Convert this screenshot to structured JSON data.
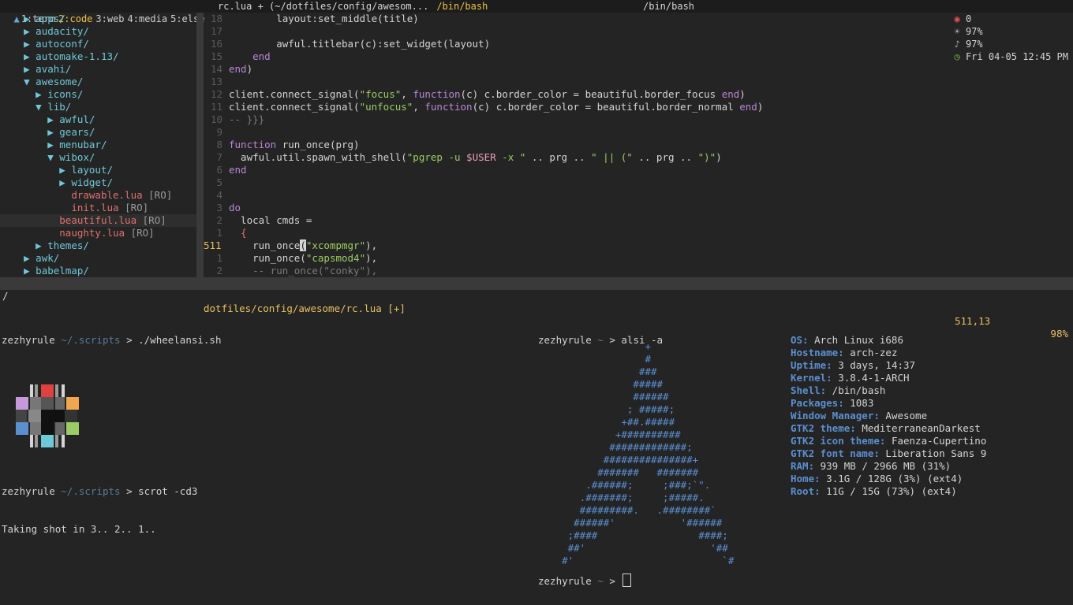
{
  "topbar": {
    "workspaces": [
      {
        "label": "1:term",
        "active": false
      },
      {
        "label": "2:code",
        "active": true
      },
      {
        "label": "3:web",
        "active": false
      },
      {
        "label": "4:media",
        "active": false
      },
      {
        "label": "5:else",
        "active": false
      }
    ],
    "window_title": "rc.lua + (~/dotfiles/config/awesom...",
    "window_shell": "/bin/bash",
    "center_title": "/bin/bash",
    "status": {
      "mail": "0",
      "brightness": "97%",
      "volume": "97%",
      "clock": "Fri 04-05 12:45 PM"
    }
  },
  "tree": [
    {
      "indent": 2,
      "arrow": "▶",
      "name": "apps/",
      "type": "dir"
    },
    {
      "indent": 2,
      "arrow": "▶",
      "name": "audacity/",
      "type": "dir"
    },
    {
      "indent": 2,
      "arrow": "▶",
      "name": "autoconf/",
      "type": "dir"
    },
    {
      "indent": 2,
      "arrow": "▶",
      "name": "automake-1.13/",
      "type": "dir"
    },
    {
      "indent": 2,
      "arrow": "▶",
      "name": "avahi/",
      "type": "dir"
    },
    {
      "indent": 2,
      "arrow": "▼",
      "name": "awesome/",
      "type": "dir"
    },
    {
      "indent": 4,
      "arrow": "▶",
      "name": "icons/",
      "type": "dir"
    },
    {
      "indent": 4,
      "arrow": "▼",
      "name": "lib/",
      "type": "dir"
    },
    {
      "indent": 6,
      "arrow": "▶",
      "name": "awful/",
      "type": "dir"
    },
    {
      "indent": 6,
      "arrow": "▶",
      "name": "gears/",
      "type": "dir"
    },
    {
      "indent": 6,
      "arrow": "▶",
      "name": "menubar/",
      "type": "dir"
    },
    {
      "indent": 6,
      "arrow": "▼",
      "name": "wibox/",
      "type": "dir"
    },
    {
      "indent": 8,
      "arrow": "▶",
      "name": "layout/",
      "type": "dir"
    },
    {
      "indent": 8,
      "arrow": "▶",
      "name": "widget/",
      "type": "dir"
    },
    {
      "indent": 10,
      "arrow": "",
      "name": "drawable.lua",
      "type": "file",
      "tag": "[RO]"
    },
    {
      "indent": 10,
      "arrow": "",
      "name": "init.lua",
      "type": "file",
      "tag": "[RO]"
    },
    {
      "indent": 8,
      "arrow": "",
      "name": "beautiful.lua",
      "type": "file",
      "tag": "[RO]",
      "highlight": true
    },
    {
      "indent": 8,
      "arrow": "",
      "name": "naughty.lua",
      "type": "file",
      "tag": "[RO]"
    },
    {
      "indent": 4,
      "arrow": "▶",
      "name": "themes/",
      "type": "dir"
    },
    {
      "indent": 2,
      "arrow": "▶",
      "name": "awk/",
      "type": "dir"
    },
    {
      "indent": 2,
      "arrow": "▶",
      "name": "babelmap/",
      "type": "dir"
    }
  ],
  "code": [
    {
      "ln": "18",
      "html": "        layout:set_middle(title)"
    },
    {
      "ln": "17",
      "html": ""
    },
    {
      "ln": "16",
      "html": "        awful.titlebar(c):set_widget(layout)"
    },
    {
      "ln": "15",
      "html": "    <span class='kw'>end</span>"
    },
    {
      "ln": "14",
      "html": "<span class='kw'>end</span>)"
    },
    {
      "ln": "13",
      "html": ""
    },
    {
      "ln": "12",
      "html": "client.connect_signal(<span class='str'>\"focus\"</span>, <span class='kw'>function</span>(c) c.border_color = beautiful.border_focus <span class='kw'>end</span>)"
    },
    {
      "ln": "11",
      "html": "client.connect_signal(<span class='str'>\"unfocus\"</span>, <span class='kw'>function</span>(c) c.border_color = beautiful.border_normal <span class='kw'>end</span>)"
    },
    {
      "ln": "10",
      "html": "<span class='com'>-- }}}</span>"
    },
    {
      "ln": "9",
      "html": ""
    },
    {
      "ln": "8",
      "html": "<span class='kw'>function</span> run_once(prg)"
    },
    {
      "ln": "7",
      "html": "  awful.util.spawn_with_shell(<span class='str'>\"pgrep -u </span><span class='var'>$USER</span><span class='str'> -x \"</span> .. prg .. <span class='str'>\" || (\"</span> .. prg .. <span class='str'>\")\"</span>)"
    },
    {
      "ln": "6",
      "html": "<span class='kw'>end</span>"
    },
    {
      "ln": "5",
      "html": ""
    },
    {
      "ln": "4",
      "html": ""
    },
    {
      "ln": "3",
      "html": "<span class='kw'>do</span>"
    },
    {
      "ln": "2",
      "html": "  local cmds ="
    },
    {
      "ln": "1",
      "html": "  <span class='brace'>{</span>"
    },
    {
      "ln": "511",
      "cur": true,
      "html": "    run_once<span class='cursor'>(</span><span class='str'>\"xcompmgr\"</span>),"
    },
    {
      "ln": "1",
      "html": "    run_once(<span class='str'>\"capsmod4\"</span>),"
    },
    {
      "ln": "2",
      "html": "    <span class='com'>-- run_once(\"conky\"),</span>"
    }
  ],
  "statusline": {
    "left": "/",
    "file": "dotfiles/config/awesome/rc.lua [+]",
    "position": "511,13",
    "percent": "98%"
  },
  "term1": {
    "prompt1": {
      "user": "zezhyrule",
      "path": "~/.scripts",
      "arrow": ">",
      "cmd": "./wheelansi.sh"
    },
    "prompt2": {
      "user": "zezhyrule",
      "path": "~/.scripts",
      "arrow": ">",
      "cmd": "scrot -cd3"
    },
    "output": "Taking shot in 3.. 2.. 1.."
  },
  "term2": {
    "prompt1": {
      "user": "zezhyrule",
      "path": "~",
      "arrow": ">",
      "cmd": "alsi -a"
    },
    "prompt2": {
      "user": "zezhyrule",
      "path": "~",
      "arrow": ">"
    },
    "arch_art": "                  +\n                  #\n                 ###\n                #####\n                ######\n               ; #####;\n              +##.#####\n             +##########\n            #############;\n           ###############+\n          #######   #######\n        .######;     ;###;`\".\n       .#######;     ;#####.\n       #########.   .########`\n      ######'           '######\n     ;####                 ####;\n     ##'                     '##\n    #'                         `#",
    "info": [
      {
        "k": "OS:",
        "v": " Arch Linux i686"
      },
      {
        "k": "Hostname:",
        "v": " arch-zez"
      },
      {
        "k": "Uptime:",
        "v": " 3 days, 14:37"
      },
      {
        "k": "Kernel:",
        "v": " 3.8.4-1-ARCH"
      },
      {
        "k": "Shell:",
        "v": " /bin/bash"
      },
      {
        "k": "Packages:",
        "v": " 1083"
      },
      {
        "k": "Window Manager:",
        "v": " Awesome"
      },
      {
        "k": "GTK2 theme:",
        "v": " MediterraneanDarkest"
      },
      {
        "k": "GTK2 icon theme:",
        "v": " Faenza-Cupertino"
      },
      {
        "k": "GTK2 font name:",
        "v": " Liberation Sans 9"
      },
      {
        "k": "RAM:",
        "v": " 939 MB / 2966 MB (31%)"
      },
      {
        "k": "Home:",
        "v": " 3.1G / 128G (3%) (ext4)"
      },
      {
        "k": "Root:",
        "v": " 11G / 15G (73%) (ext4)"
      }
    ]
  },
  "colors": {
    "bg": "#242424",
    "accent": "#f0c040",
    "dir": "#6fc8d8",
    "file": "#e07070",
    "arch": "#5b8fd0"
  }
}
